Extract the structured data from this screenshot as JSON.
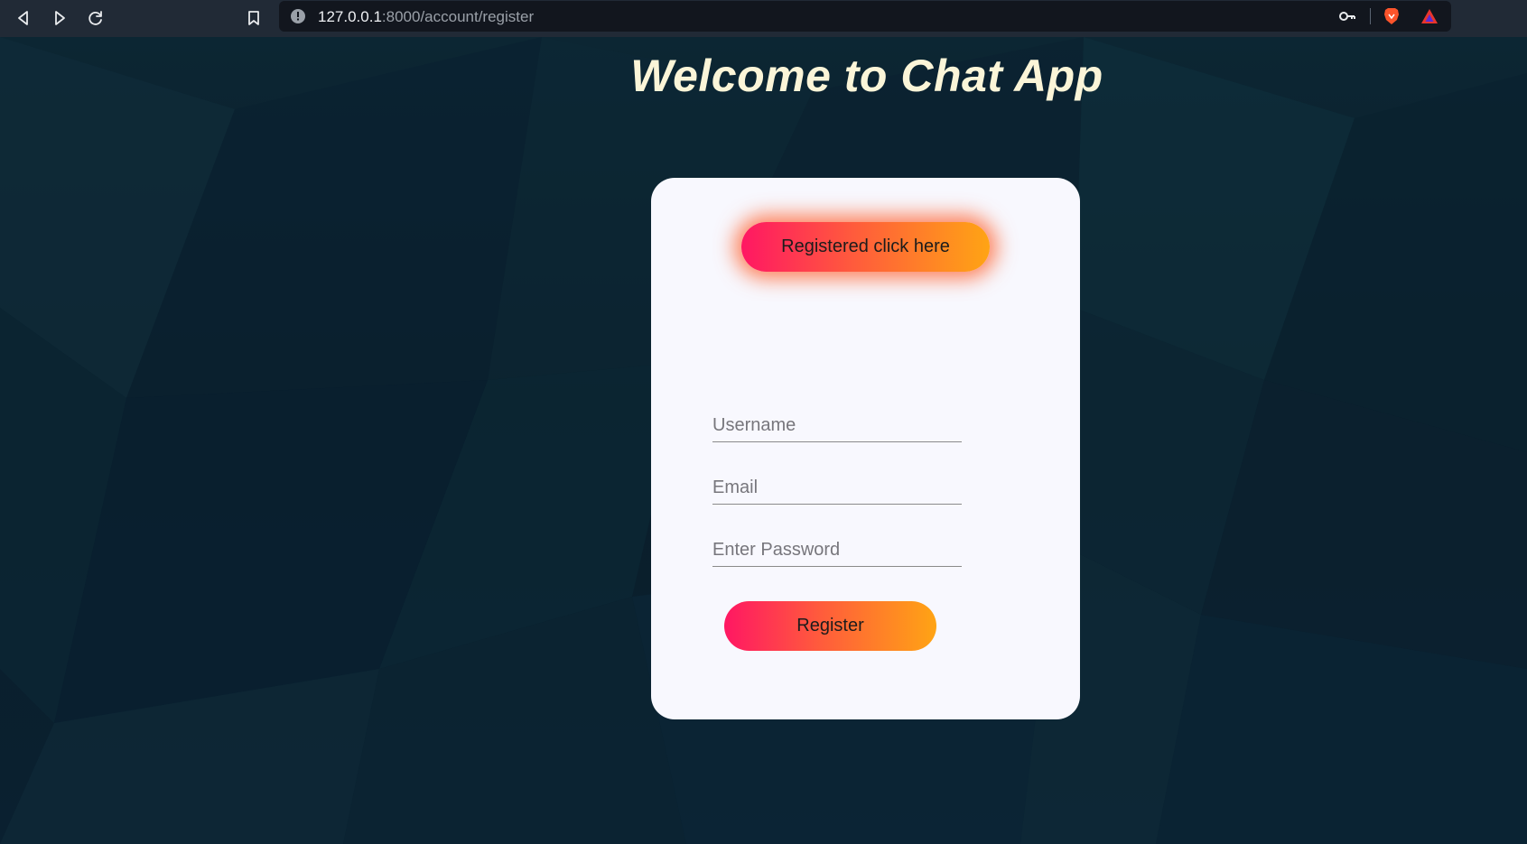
{
  "browser": {
    "url_host": "127.0.0.1",
    "url_rest": ":8000/account/register",
    "icons": {
      "back": "back-arrow-icon",
      "forward": "forward-arrow-icon",
      "reload": "reload-icon",
      "bookmark": "bookmark-icon",
      "site_info": "info-icon",
      "key": "key-icon",
      "brave": "brave-lion-icon",
      "rewards": "brave-rewards-icon"
    }
  },
  "page": {
    "title": "Welcome to Chat App"
  },
  "form": {
    "toggle_button": "Registered click here",
    "username_placeholder": "Username",
    "email_placeholder": "Email",
    "password_placeholder": "Enter Password",
    "submit_label": "Register"
  },
  "colors": {
    "background": "#0b2230",
    "card": "#f8f8fe",
    "title": "#fbf5d8",
    "gradient_start": "#ff1763",
    "gradient_end": "#ffa414"
  }
}
